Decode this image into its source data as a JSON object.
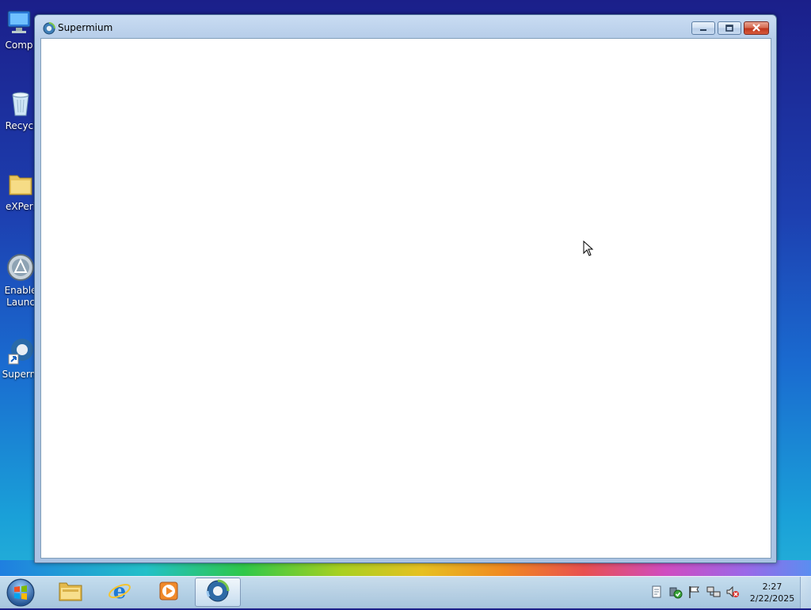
{
  "desktop": {
    "icons": [
      {
        "label": "Comp",
        "icon": "computer-icon"
      },
      {
        "label": "Recycl",
        "icon": "recycle-bin-icon"
      },
      {
        "label": "eXPeri",
        "icon": "folder-icon"
      },
      {
        "label": "Enable\nLaunc",
        "icon": "launcher-icon"
      },
      {
        "label": "Superm",
        "icon": "supermium-shortcut-icon"
      }
    ]
  },
  "window": {
    "title": "Supermium",
    "icon": "supermium-icon",
    "controls": {
      "minimize": "minimize-icon",
      "maximize": "maximize-icon",
      "close": "close-icon"
    }
  },
  "taskbar": {
    "start": "windows-start-icon",
    "pinned": [
      {
        "name": "explorer",
        "icon": "folder-icon"
      },
      {
        "name": "internet-explorer",
        "icon": "ie-icon"
      },
      {
        "name": "media-player",
        "icon": "media-player-icon"
      },
      {
        "name": "supermium",
        "icon": "supermium-icon",
        "active": true
      }
    ],
    "tray": [
      "notes-icon",
      "security-icon",
      "flag-icon",
      "network-icon",
      "volume-muted-icon"
    ],
    "clock": {
      "time": "2:27",
      "date": "2/22/2025"
    }
  },
  "colors": {
    "accent": "#1d3fb0",
    "close_red": "#c0361d"
  }
}
